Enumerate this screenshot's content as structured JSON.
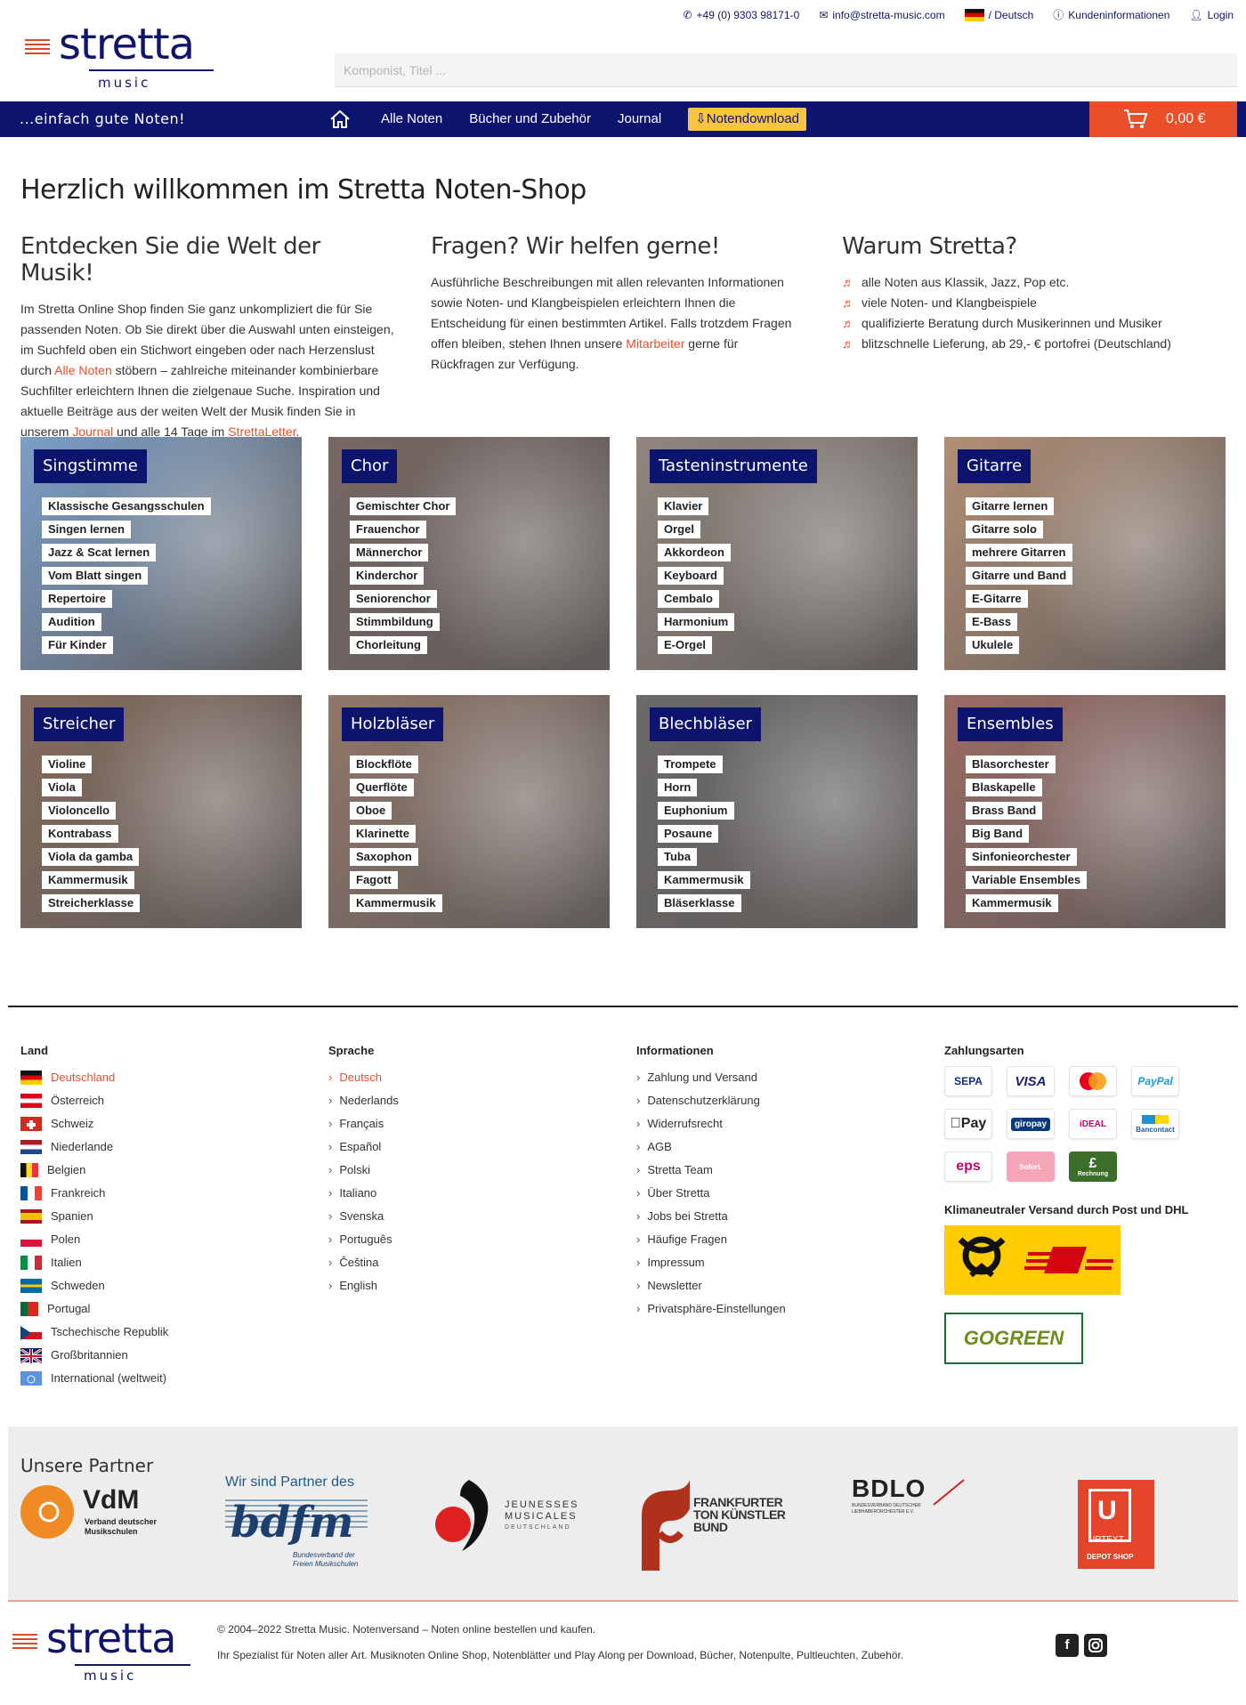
{
  "header": {
    "logo_word": "stretta",
    "logo_sub": "music",
    "phone": "+49 (0) 9303 98171-0",
    "email": "info@stretta-music.com",
    "language": "/ Deutsch",
    "customer_info": "Kundeninformationen",
    "login": "Login",
    "search_placeholder": "Komponist, Titel ..."
  },
  "nav": {
    "slogan": "...einfach gute Noten!",
    "links": [
      "Alle Noten",
      "Bücher und Zubehör",
      "Journal"
    ],
    "download": "Notendownload",
    "cart_amount": "0,00 €"
  },
  "welcome": {
    "title": "Herzlich willkommen im Stretta Noten-Shop",
    "col1": {
      "heading": "Entdecken Sie die Welt der Musik!",
      "text_a": "Im Stretta Online Shop finden Sie ganz unkompliziert die für Sie passenden Noten. Ob Sie direkt über die Auswahl unten einsteigen, im Suchfeld oben ein Stichwort eingeben oder nach Herzenslust durch ",
      "link_a": "Alle Noten",
      "text_b": " stöbern – zahlreiche miteinander kombinierbare Suchfilter erleichtern Ihnen die zielgenaue Suche. Inspiration und aktuelle Beiträge aus der weiten Welt der Musik finden Sie in unserem ",
      "link_b": "Journal",
      "text_c": " und alle 14 Tage im ",
      "link_c": "StrettaLetter",
      "text_d": "."
    },
    "col2": {
      "heading": "Fragen? Wir helfen gerne!",
      "text_a": "Ausführliche Beschreibungen mit allen relevanten Informationen sowie Noten- und Klangbeispielen erleichtern Ihnen die Entscheidung für einen bestimmten Artikel. Falls trotzdem Fragen offen bleiben, stehen Ihnen unsere ",
      "link_a": "Mitarbeiter",
      "text_b": " gerne für Rückfragen zur Verfügung."
    },
    "col3": {
      "heading": "Warum Stretta?",
      "items": [
        "alle Noten aus Klassik, Jazz, Pop etc.",
        "viele Noten- und Klangbeispiele",
        "qualifizierte Beratung durch Musikerinnen und Musiker",
        "blitzschnelle Lieferung, ab 29,- € portofrei (Deutschland)"
      ]
    }
  },
  "tiles": [
    {
      "title": "Singstimme",
      "tags": [
        "Klassische Gesangsschulen",
        "Singen lernen",
        "Jazz & Scat lernen",
        "Vom Blatt singen",
        "Repertoire",
        "Audition",
        "Für Kinder"
      ],
      "color": "#4f7fb6"
    },
    {
      "title": "Chor",
      "tags": [
        "Gemischter Chor",
        "Frauenchor",
        "Männerchor",
        "Kinderchor",
        "Seniorenchor",
        "Stimmbildung",
        "Chorleitung"
      ],
      "color": "#4a3530"
    },
    {
      "title": "Tasteninstrumente",
      "tags": [
        "Klavier",
        "Orgel",
        "Akkordeon",
        "Keyboard",
        "Cembalo",
        "Harmonium",
        "E-Orgel"
      ],
      "color": "#6e5f55"
    },
    {
      "title": "Gitarre",
      "tags": [
        "Gitarre lernen",
        "Gitarre solo",
        "mehrere Gitarren",
        "Gitarre und Band",
        "E-Gitarre",
        "E-Bass",
        "Ukulele"
      ],
      "color": "#9a6a47"
    },
    {
      "title": "Streicher",
      "tags": [
        "Violine",
        "Viola",
        "Violoncello",
        "Kontrabass",
        "Viola da gamba",
        "Kammermusik",
        "Streicherklasse"
      ],
      "color": "#5c3a26"
    },
    {
      "title": "Holzbläser",
      "tags": [
        "Blockflöte",
        "Querflöte",
        "Oboe",
        "Klarinette",
        "Saxophon",
        "Fagott",
        "Kammermusik"
      ],
      "color": "#6d4a38"
    },
    {
      "title": "Blechbläser",
      "tags": [
        "Trompete",
        "Horn",
        "Euphonium",
        "Posaune",
        "Tuba",
        "Kammermusik",
        "Bläserklasse"
      ],
      "color": "#3a3836"
    },
    {
      "title": "Ensembles",
      "tags": [
        "Blasorchester",
        "Blaskapelle",
        "Brass Band",
        "Big Band",
        "Sinfonieorchester",
        "Variable Ensembles",
        "Kammermusik"
      ],
      "color": "#7a3a30"
    }
  ],
  "footer": {
    "land": {
      "heading": "Land",
      "items": [
        "Deutschland",
        "Österreich",
        "Schweiz",
        "Niederlande",
        "Belgien",
        "Frankreich",
        "Spanien",
        "Polen",
        "Italien",
        "Schweden",
        "Portugal",
        "Tschechische Republik",
        "Großbritannien",
        "International (weltweit)"
      ]
    },
    "sprache": {
      "heading": "Sprache",
      "items": [
        "Deutsch",
        "Nederlands",
        "Français",
        "Español",
        "Polski",
        "Italiano",
        "Svenska",
        "Português",
        "Čeština",
        "English"
      ]
    },
    "info": {
      "heading": "Informationen",
      "items": [
        "Zahlung und Versand",
        "Datenschutzerklärung",
        "Widerrufsrecht",
        "AGB",
        "Stretta Team",
        "Über Stretta",
        "Jobs bei Stretta",
        "Häufige Fragen",
        "Impressum",
        "Newsletter",
        "Privatsphäre-Einstellungen"
      ]
    },
    "payment": {
      "heading": "Zahlungsarten",
      "methods": [
        "SEPA",
        "VISA",
        "mastercard",
        "PayPal",
        "Pay",
        "giropay",
        "iDEAL",
        "Bancontact",
        "eps",
        "Sofort.",
        "Rechnung"
      ],
      "shipping_heading": "Klimaneutraler Versand durch Post und DHL",
      "gogreen": "GOGREEN"
    }
  },
  "partners": {
    "heading": "Unsere Partner",
    "vdm": "VdM",
    "vdm_sub": "Verband deutscher Musikschulen",
    "bdfm_top": "Wir sind Partner des",
    "bdfm": "bdfm",
    "bdfm_sub": "Bundesverband der Freien Musikschulen",
    "jm": "JEUNESSES MUSICALES",
    "jm_sub": "DEUTSCHLAND",
    "ftb": "FRANKFURTER TON KÜNSTLER BUND",
    "bdlo": "BDLO",
    "bdlo_sub": "BUNDESVERBAND DEUTSCHER LIEBHABERORCHESTER E.V.",
    "urtext": "URTEXT",
    "urtext_sub": "DEPOT SHOP"
  },
  "bottom": {
    "copyright": "© 2004–2022 Stretta Music. Notenversand – Noten online bestellen und kaufen.",
    "specialist": "Ihr Spezialist für Noten aller Art. Musiknoten Online Shop, Notenblätter und Play Along per Download, Bücher, Notenpulte, Pultleuchten, Zubehör."
  },
  "colors": {
    "navy": "#0c146e",
    "accent": "#e9502a",
    "download": "#f7c541"
  }
}
